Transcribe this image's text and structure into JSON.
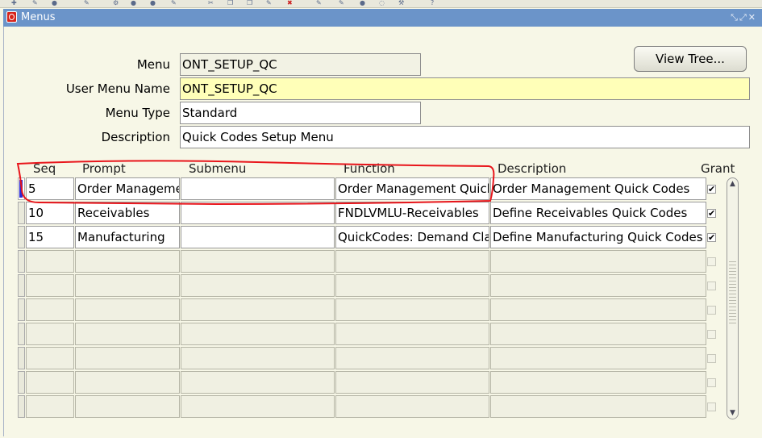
{
  "window": {
    "title": "Menus"
  },
  "form": {
    "menu_label": "Menu",
    "menu_value": "ONT_SETUP_QC",
    "user_menu_name_label": "User Menu Name",
    "user_menu_name_value": "ONT_SETUP_QC",
    "menu_type_label": "Menu Type",
    "menu_type_value": "Standard",
    "description_label": "Description",
    "description_value": "Quick Codes Setup Menu",
    "view_tree_label": "View Tree..."
  },
  "grid": {
    "headers": {
      "seq": "Seq",
      "prompt": "Prompt",
      "submenu": "Submenu",
      "function": "Function",
      "description": "Description",
      "grant": "Grant"
    },
    "rows": [
      {
        "seq": "5",
        "prompt": "Order Management",
        "submenu": "",
        "function": "Order Management Quick Codes",
        "description": "Order Management Quick Codes",
        "grant": true
      },
      {
        "seq": "10",
        "prompt": "Receivables",
        "submenu": "",
        "function": "FNDLVMLU-Receivables",
        "description": "Define Receivables Quick Codes",
        "grant": true
      },
      {
        "seq": "15",
        "prompt": "Manufacturing",
        "submenu": "",
        "function": "QuickCodes: Demand Class",
        "description": "Define Manufacturing Quick Codes",
        "grant": true
      }
    ],
    "empty_rows": 7
  },
  "colors": {
    "titlebar": "#6b94c9",
    "required_field": "#ffffb8",
    "annotation": "#e8151b",
    "current_record": "#2a2ad6"
  }
}
